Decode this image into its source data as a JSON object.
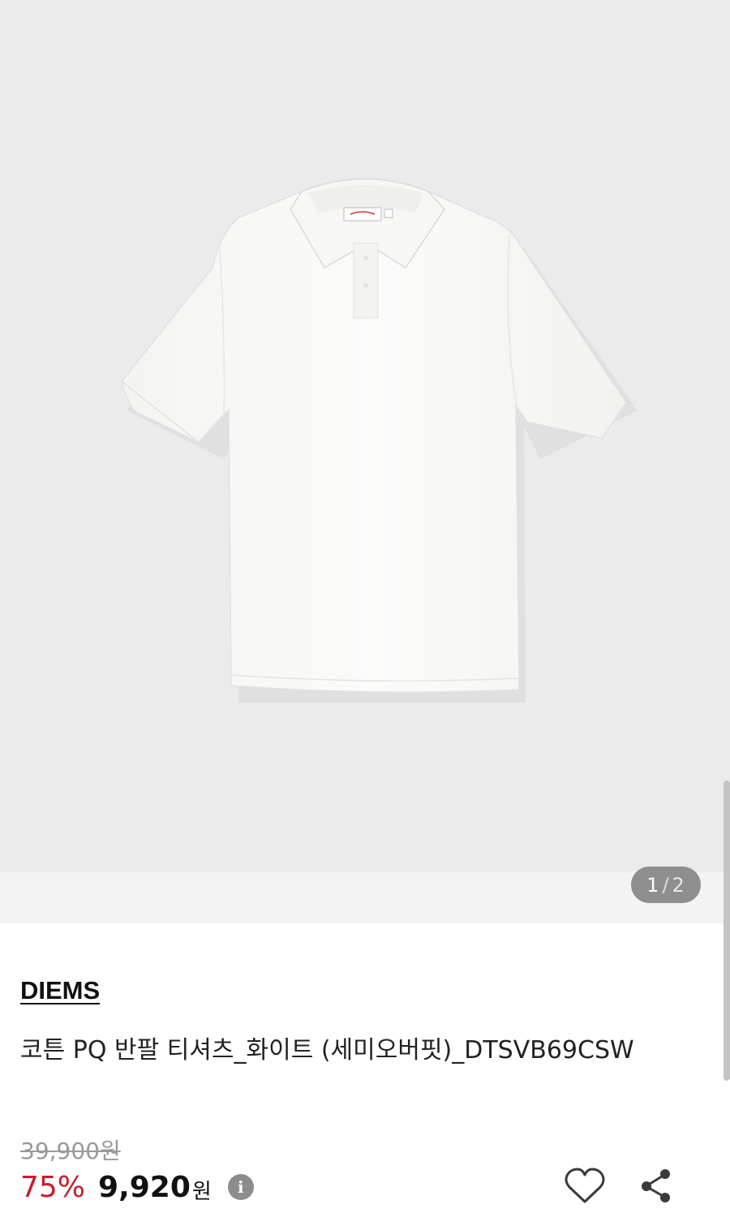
{
  "gallery": {
    "current_page": "1",
    "separator": "/",
    "total_pages": "2"
  },
  "product": {
    "brand": "DIEMS",
    "title": "코튼 PQ 반팔 티셔츠_화이트 (세미오버핏)_DTSVB69CSW",
    "original_price": "39,900원",
    "discount": "75%",
    "sale_price": "9,920",
    "currency": "원"
  },
  "icons": {
    "info": "info-icon",
    "wishlist": "heart-icon",
    "share": "share-icon"
  },
  "colors": {
    "discount": "#c81d2b",
    "indicator_bg": "#8e8e8e"
  }
}
